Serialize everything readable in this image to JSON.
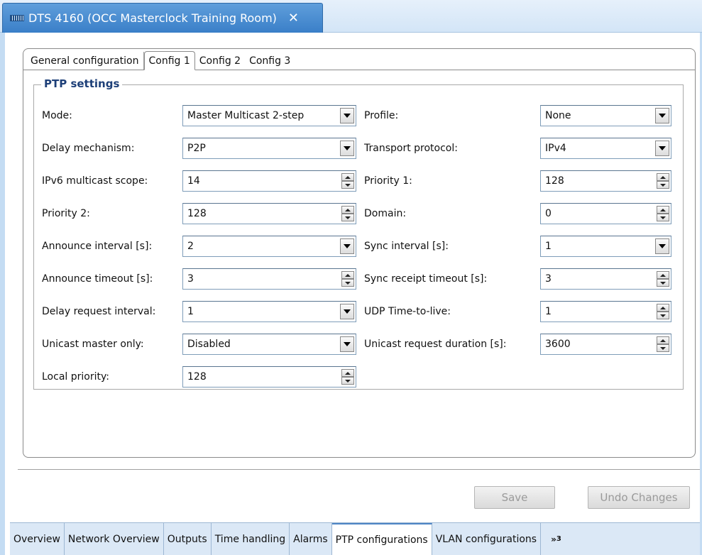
{
  "window": {
    "title": "DTS 4160 (OCC Masterclock Training Room)",
    "close_glyph": "✕"
  },
  "config_tabs": [
    {
      "label": "General configuration"
    },
    {
      "label": "Config 1"
    },
    {
      "label": "Config 2"
    },
    {
      "label": "Config 3"
    }
  ],
  "ptp": {
    "group_title": "PTP settings",
    "left": [
      {
        "label": "Mode:",
        "value": "Master Multicast 2-step",
        "control": "dropdown"
      },
      {
        "label": "Delay mechanism:",
        "value": "P2P",
        "control": "dropdown"
      },
      {
        "label": "IPv6 multicast scope:",
        "value": "14",
        "control": "spinner"
      },
      {
        "label": "Priority 2:",
        "value": "128",
        "control": "spinner"
      },
      {
        "label": "Announce interval [s]:",
        "value": "2",
        "control": "dropdown"
      },
      {
        "label": "Announce timeout [s]:",
        "value": "3",
        "control": "spinner"
      },
      {
        "label": "Delay request interval:",
        "value": "1",
        "control": "dropdown"
      },
      {
        "label": "Unicast master only:",
        "value": "Disabled",
        "control": "dropdown"
      },
      {
        "label": "Local priority:",
        "value": "128",
        "control": "spinner"
      }
    ],
    "right": [
      {
        "label": "Profile:",
        "value": "None",
        "control": "dropdown"
      },
      {
        "label": "Transport protocol:",
        "value": "IPv4",
        "control": "dropdown"
      },
      {
        "label": "Priority 1:",
        "value": "128",
        "control": "spinner"
      },
      {
        "label": "Domain:",
        "value": "0",
        "control": "spinner"
      },
      {
        "label": "Sync interval [s]:",
        "value": "1",
        "control": "dropdown"
      },
      {
        "label": "Sync receipt timeout  [s]:",
        "value": "3",
        "control": "spinner"
      },
      {
        "label": "UDP Time-to-live:",
        "value": "1",
        "control": "spinner"
      },
      {
        "label": "Unicast request duration [s]:",
        "value": "3600",
        "control": "spinner"
      }
    ]
  },
  "actions": {
    "save_label": "Save",
    "undo_label": "Undo Changes"
  },
  "bottom_tabs": [
    {
      "label": "Overview"
    },
    {
      "label": "Network Overview"
    },
    {
      "label": "Outputs"
    },
    {
      "label": "Time handling"
    },
    {
      "label": "Alarms"
    },
    {
      "label": "PTP configurations"
    },
    {
      "label": "VLAN configurations"
    }
  ],
  "overflow_tab": {
    "chevron": "»",
    "count": "3"
  },
  "colors": {
    "title_tab": "#3a7fc8",
    "group_title": "#1d3f78",
    "frame": "#c4dcf3"
  }
}
